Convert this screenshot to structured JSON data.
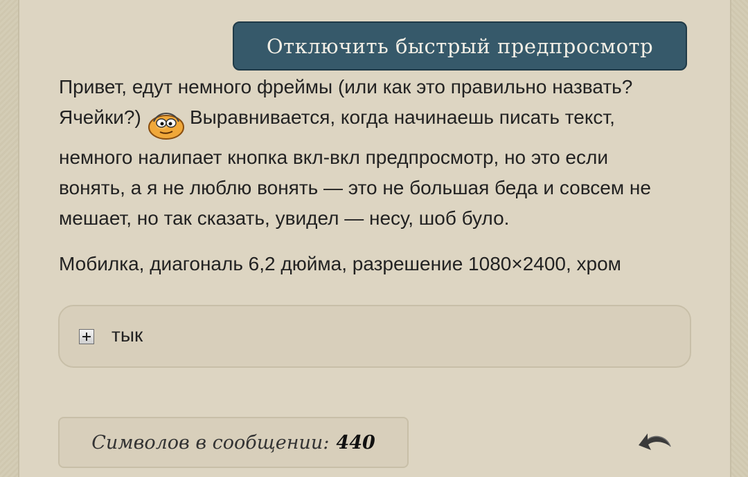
{
  "toolbar": {
    "preview_toggle_label": "Отключить быстрый предпросмотр"
  },
  "message": {
    "line1": "Привет, едут немного фреймы (или как это правильно назвать?",
    "line2_before_smiley": "Ячейки?)",
    "line2_after_smiley": "Выравнивается, когда начинаешь писать текст,",
    "line3": "немного налипает кнопка вкл-вкл предпросмотр, но это если",
    "line4": "вонять, а я не люблю вонять — это не большая беда и совсем не",
    "line5": "мешает, но так сказать, увидел — несу, шоб було.",
    "line6": "Мобилка,  диагональ 6,2 дюйма, разрешение 1080×2400, хром",
    "smiley_icon": "confused-smiley-icon"
  },
  "spoiler": {
    "toggle_icon": "plus-box-icon",
    "label": "тык"
  },
  "footer": {
    "counter_label": "Символов в сообщении:",
    "counter_value": "440",
    "undo_icon": "undo-arrow-icon"
  },
  "colors": {
    "page_background": "#ddd5c2",
    "button_background": "#36596a",
    "button_text": "#f2efe6",
    "text": "#222222",
    "box_border": "#c8bfa8"
  }
}
